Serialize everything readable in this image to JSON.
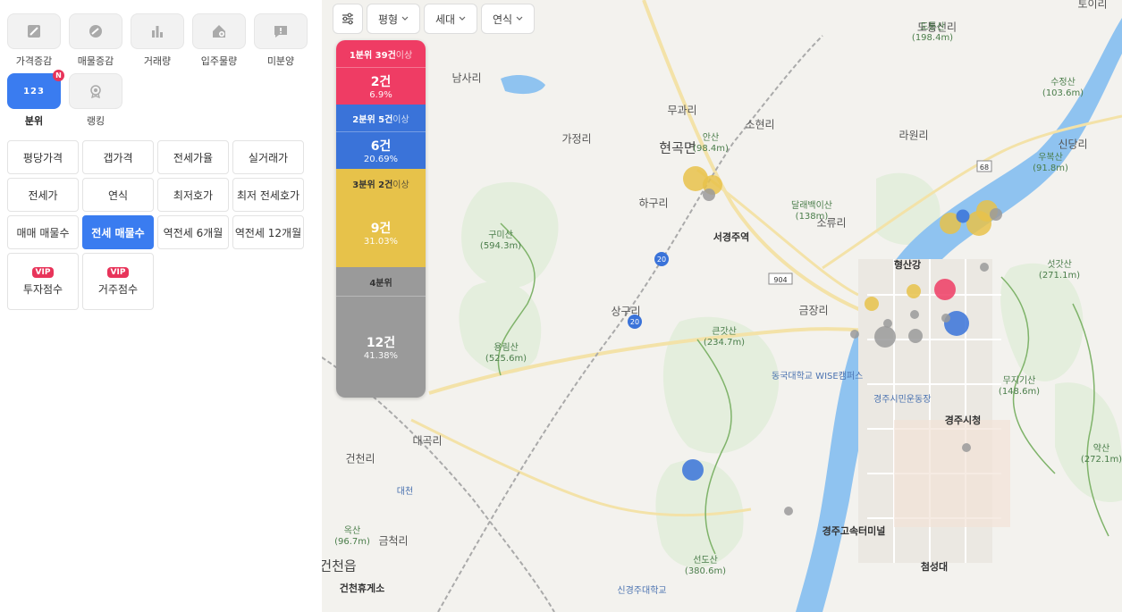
{
  "tools_row1": [
    {
      "name": "price-change-tool",
      "icon": "price-change-icon",
      "label": "가격증감"
    },
    {
      "name": "listing-change-tool",
      "icon": "listing-change-icon",
      "label": "매물증감"
    },
    {
      "name": "volume-tool",
      "icon": "bar-chart-icon",
      "label": "거래량"
    },
    {
      "name": "supply-tool",
      "icon": "house-plus-icon",
      "label": "입주물량"
    },
    {
      "name": "unsold-tool",
      "icon": "alert-chat-icon",
      "label": "미분양"
    }
  ],
  "tools_row2": [
    {
      "name": "quantile-tool",
      "icon": "123-icon",
      "label": "분위",
      "badge": "123",
      "new_badge": "N",
      "active": true
    },
    {
      "name": "ranking-tool",
      "icon": "medal-icon",
      "label": "랭킹"
    }
  ],
  "metrics": [
    [
      "평당가격",
      "갭가격",
      "전세가율",
      "실거래가"
    ],
    [
      "전세가",
      "연식",
      "최저호가",
      "최저 전세호가"
    ],
    [
      "매매 매물수",
      "전세 매물수",
      "역전세 6개월",
      "역전세 12개월"
    ]
  ],
  "selected_metric": "전세 매물수",
  "score_buttons": [
    {
      "badge": "VIP",
      "label": "투자점수"
    },
    {
      "badge": "VIP",
      "label": "거주점수"
    }
  ],
  "map_controls": {
    "filter_icon": "filter-sliders-icon",
    "dropdowns": [
      {
        "label": "평형",
        "icon": "chevron-down-icon"
      },
      {
        "label": "세대",
        "icon": "chevron-down-icon"
      },
      {
        "label": "연식",
        "icon": "chevron-down-icon"
      }
    ]
  },
  "legend": [
    {
      "header": "1분위 39건",
      "suffix": "이상",
      "count": "2건",
      "pct": "6.9%",
      "color": "#ef3c64",
      "fraction": 0.069
    },
    {
      "header": "2분위 5건",
      "suffix": "이상",
      "count": "6건",
      "pct": "20.69%",
      "color": "#3a73d9",
      "fraction": 0.2069
    },
    {
      "header": "3분위 2건",
      "suffix": "이상",
      "count": "9건",
      "pct": "31.03%",
      "color": "#e7c24a",
      "fraction": 0.3103
    },
    {
      "header": "4분위",
      "suffix": "",
      "count": "12건",
      "pct": "41.38%",
      "color": "#9a9a9a",
      "fraction": 0.4138
    }
  ],
  "map_labels": {
    "places": [
      "남사리",
      "무과리",
      "소현리",
      "가정리",
      "현곡면",
      "하구리",
      "서경주역",
      "라원리",
      "신당리",
      "소류리",
      "형산강",
      "금장리",
      "상구리",
      "대곡리",
      "건천리",
      "대천",
      "금척리",
      "건천읍",
      "건천휴게소",
      "경주시청",
      "경주고속터미널",
      "첨성대",
      "경주시민운동장",
      "동국대학교 WISE캠퍼스",
      "신경주대학교",
      "도통신리",
      "토이리"
    ],
    "mountains": [
      {
        "name": "도통산",
        "height": "(198.4m)"
      },
      {
        "name": "수정산",
        "height": "(103.6m)"
      },
      {
        "name": "우복산",
        "height": "(91.8m)"
      },
      {
        "name": "안산",
        "height": "(98.4m)"
      },
      {
        "name": "달래백이산",
        "height": "(138m)"
      },
      {
        "name": "구미산",
        "height": "(594.3m)"
      },
      {
        "name": "섯갓산",
        "height": "(271.1m)"
      },
      {
        "name": "큰갓산",
        "height": "(234.7m)"
      },
      {
        "name": "용림산",
        "height": "(525.6m)"
      },
      {
        "name": "무지기산",
        "height": "(148.6m)"
      },
      {
        "name": "약산",
        "height": "(272.1m)"
      },
      {
        "name": "옥산",
        "height": "(96.7m)"
      },
      {
        "name": "선도산",
        "height": "(380.6m)"
      }
    ],
    "routes": [
      "68",
      "20",
      "904",
      "20"
    ]
  },
  "colors": {
    "accent": "#3a7cf0",
    "q1": "#ef3c64",
    "q2": "#3a73d9",
    "q3": "#e7c24a",
    "q4": "#9a9a9a",
    "river": "#8fc3f0"
  }
}
